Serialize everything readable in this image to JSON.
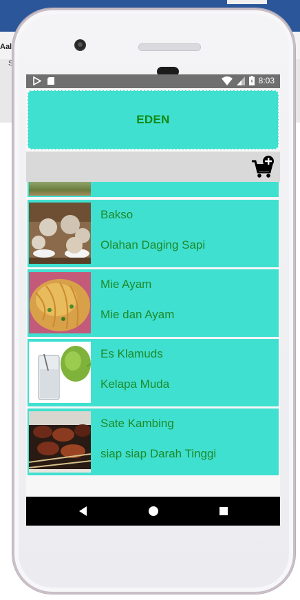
{
  "desktop": {
    "title_fragment": "Aal",
    "sub_fragment": "S"
  },
  "status_bar": {
    "time": "8:03"
  },
  "header": {
    "title": "EDEN"
  },
  "toolbar": {
    "cart_icon": "add-to-cart-icon"
  },
  "menu_items": [
    {
      "name": "Bakso",
      "desc": "Olahan Daging Sapi",
      "thumb": "bakso"
    },
    {
      "name": "Mie Ayam",
      "desc": "Mie dan Ayam",
      "thumb": "mie-ayam"
    },
    {
      "name": "Es Klamuds",
      "desc": "Kelapa Muda",
      "thumb": "es-klamuds"
    },
    {
      "name": "Sate Kambing",
      "desc": "siap siap Darah Tinggi",
      "thumb": "sate-kambing"
    }
  ],
  "colors": {
    "card": "#40e0d0",
    "text_green": "#1c8a28",
    "title_green": "#128a12"
  }
}
